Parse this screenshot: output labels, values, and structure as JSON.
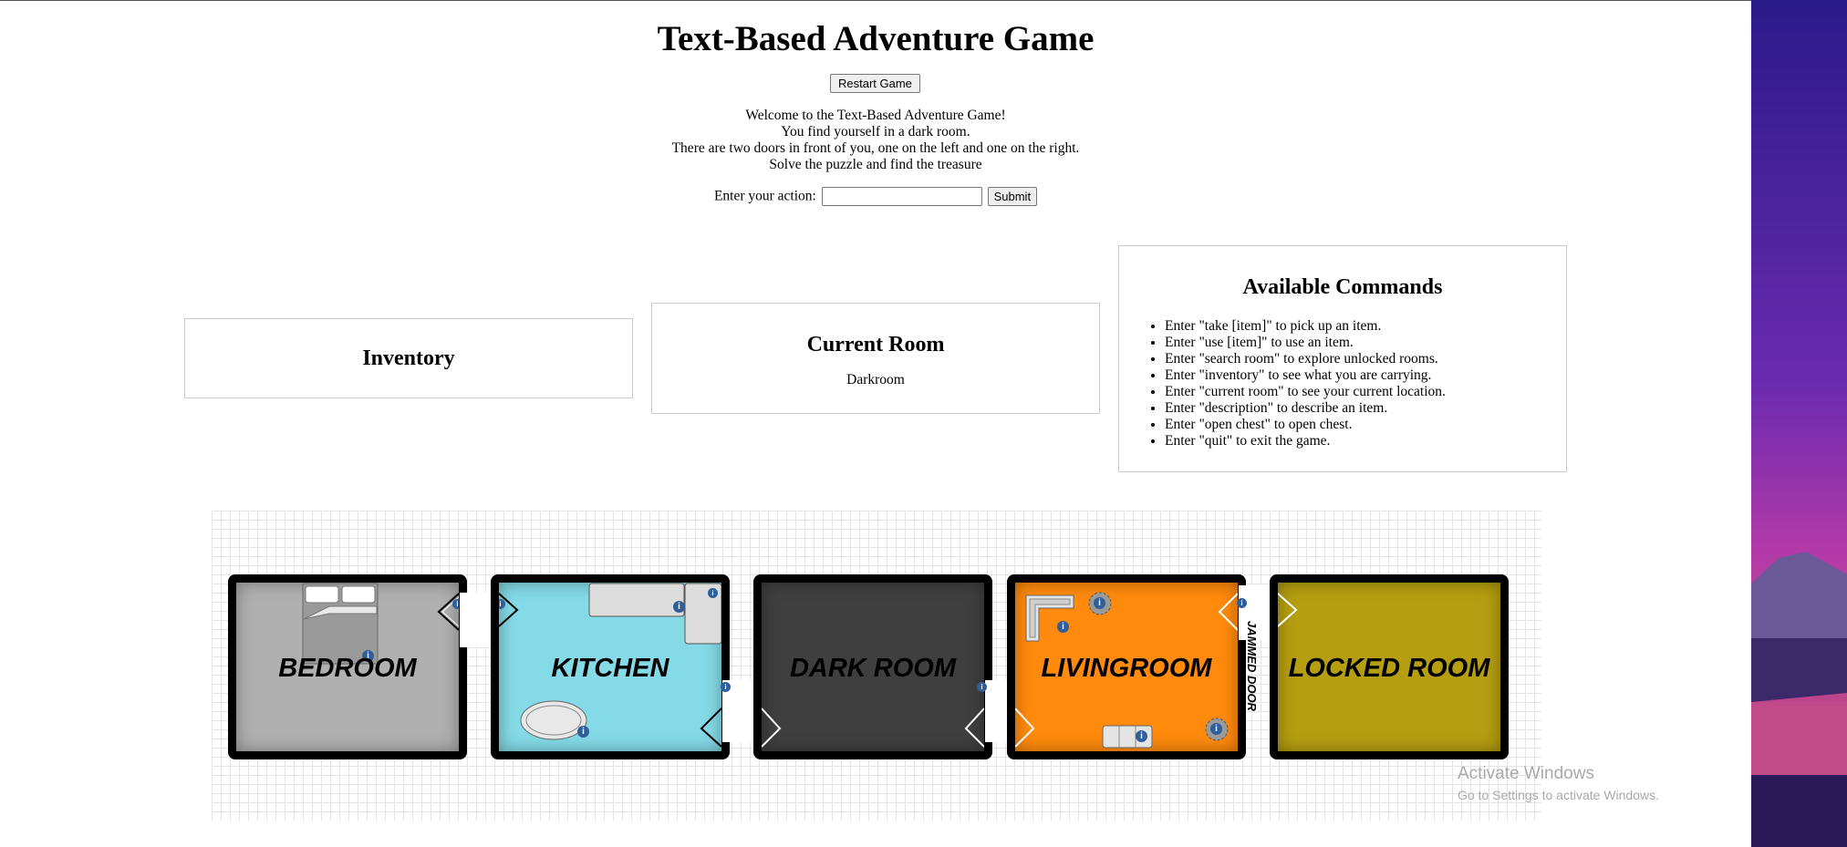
{
  "game": {
    "title": "Text-Based Adventure Game",
    "restart_label": "Restart Game",
    "intro": [
      "Welcome to the Text-Based Adventure Game!",
      "You find yourself in a dark room.",
      "There are two doors in front of you, one on the left and one on the right.",
      "Solve the puzzle and find the treasure"
    ],
    "action_label": "Enter your action:",
    "action_value": "",
    "submit_label": "Submit"
  },
  "inventory": {
    "title": "Inventory",
    "items": []
  },
  "current_room": {
    "title": "Current Room",
    "value": "Darkroom"
  },
  "commands": {
    "title": "Available Commands",
    "items": [
      "Enter \"take [item]\" to pick up an item.",
      "Enter \"use [item]\" to use an item.",
      "Enter \"search room\" to explore unlocked rooms.",
      "Enter \"inventory\" to see what you are carrying.",
      "Enter \"current room\" to see your current location.",
      "Enter \"description\" to describe an item.",
      "Enter \"open chest\" to open chest.",
      "Enter \"quit\" to exit the game."
    ]
  },
  "map": {
    "rooms": [
      {
        "label": "BEDROOM",
        "color": "#b0b0b0"
      },
      {
        "label": "KITCHEN",
        "color": "#84dae6"
      },
      {
        "label": "DARK ROOM",
        "color": "#3f3f3f"
      },
      {
        "label": "LIVINGROOM",
        "color": "#ff8a0c"
      },
      {
        "label": "LOCKED ROOM",
        "color": "#b59e10"
      }
    ],
    "jammed_door_label": "JAMMED DOOR",
    "info_icon": "info-icon"
  },
  "os_watermark": {
    "line1": "Activate Windows",
    "line2": "Go to Settings to activate Windows."
  }
}
